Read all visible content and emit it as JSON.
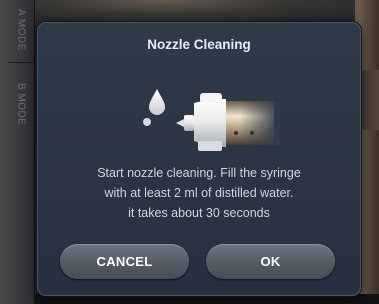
{
  "side_modes": {
    "mode_a": "A MODE",
    "mode_b": "B MODE"
  },
  "dialog": {
    "title": "Nozzle Cleaning",
    "illustration_icon": "water-drop-syringe-nozzle-icon",
    "message_lines": [
      "Start nozzle cleaning. Fill the syringe",
      "with at least 2 ml of distilled water.",
      "it takes about 30 seconds"
    ],
    "cancel_label": "CANCEL",
    "ok_label": "OK"
  },
  "colors": {
    "dialog_bg": "#2f3b49",
    "button_bg": "#5a616b",
    "text": "#cfd5dc"
  }
}
